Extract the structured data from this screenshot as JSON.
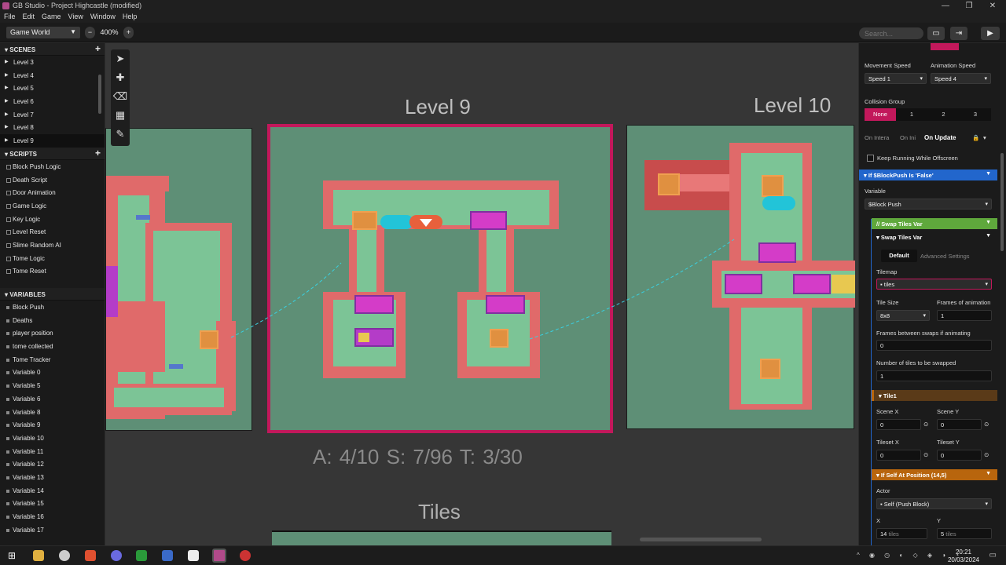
{
  "window": {
    "title": "GB Studio - Project Highcastle (modified)",
    "minimize": "—",
    "maximize": "❐",
    "close": "✕"
  },
  "menu": [
    "File",
    "Edit",
    "Game",
    "View",
    "Window",
    "Help"
  ],
  "toolbar": {
    "view_select": "Game World",
    "zoom_minus": "−",
    "zoom_value": "400%",
    "zoom_plus": "+",
    "search_placeholder": "Search...",
    "play": "▶"
  },
  "sidebar": {
    "scenes_header": "SCENES",
    "scenes": [
      "Level 3",
      "Level 4",
      "Level 5",
      "Level 6",
      "Level 7",
      "Level 8",
      "Level 9"
    ],
    "selected_scene": "Level 9",
    "scripts_header": "SCRIPTS",
    "scripts": [
      "Block Push Logic",
      "Death Script",
      "Door Animation",
      "Game Logic",
      "Key Logic",
      "Level Reset",
      "Slime Random AI",
      "Tome Logic",
      "Tome Reset"
    ],
    "variables_header": "VARIABLES",
    "variables": [
      "Block Push",
      "Deaths",
      "player position",
      "tome collected",
      "Tome Tracker",
      "Variable 0",
      "Variable 5",
      "Variable 6",
      "Variable 8",
      "Variable 9",
      "Variable 10",
      "Variable 11",
      "Variable 12",
      "Variable 13",
      "Variable 14",
      "Variable 15",
      "Variable 16",
      "Variable 17"
    ]
  },
  "canvas": {
    "scene_center_title": "Level 9",
    "scene_right_title": "Level 10",
    "stats": "A: 4/10   S: 7/96   T: 3/30",
    "tiles_title": "Tiles"
  },
  "props": {
    "movement_speed_label": "Movement Speed",
    "movement_speed_value": "Speed 1",
    "animation_speed_label": "Animation Speed",
    "animation_speed_value": "Speed 4",
    "collision_group_label": "Collision Group",
    "collision_options": [
      "None",
      "1",
      "2",
      "3"
    ],
    "tabs": [
      "On Intera",
      "On Ini",
      "On Update"
    ],
    "keep_running": "Keep Running While Offscreen",
    "if_header": "If $BlockPush Is 'False'",
    "variable_label": "Variable",
    "variable_value": "$Block Push",
    "comment_header": "// Swap Tiles Var",
    "swap_header": "Swap Tiles Var",
    "swap_tabs": [
      "Default",
      "Advanced Settings"
    ],
    "tilemap_label": "Tilemap",
    "tilemap_value": "tiles",
    "tile_size_label": "Tile Size",
    "tile_size_value": "8x8",
    "frames_anim_label": "Frames of animation",
    "frames_anim_value": "1",
    "frames_swap_label": "Frames between swaps if animating",
    "frames_swap_value": "0",
    "num_tiles_label": "Number of tiles to be swapped",
    "num_tiles_value": "1",
    "tile1_header": "Tile1",
    "scene_x_label": "Scene X",
    "scene_x_value": "0",
    "scene_y_label": "Scene Y",
    "scene_y_value": "0",
    "tileset_x_label": "Tileset X",
    "tileset_x_value": "0",
    "tileset_y_label": "Tileset Y",
    "tileset_y_value": "0",
    "if_self_header": "If Self At Position (14,5)",
    "actor_label": "Actor",
    "actor_value": "Self (Push Block)",
    "x_label": "X",
    "x_value": "14",
    "x_unit": "tiles",
    "y_label": "Y",
    "y_value": "5",
    "y_unit": "tiles"
  },
  "taskbar": {
    "time": "20:21",
    "date": "20/03/2024"
  },
  "colors": {
    "accent_pink": "#c2185b",
    "green_header": "#5fa83c",
    "blue_header": "#2266cc",
    "orange_header": "#b8650d",
    "scene_bg": "#5e8f76"
  }
}
